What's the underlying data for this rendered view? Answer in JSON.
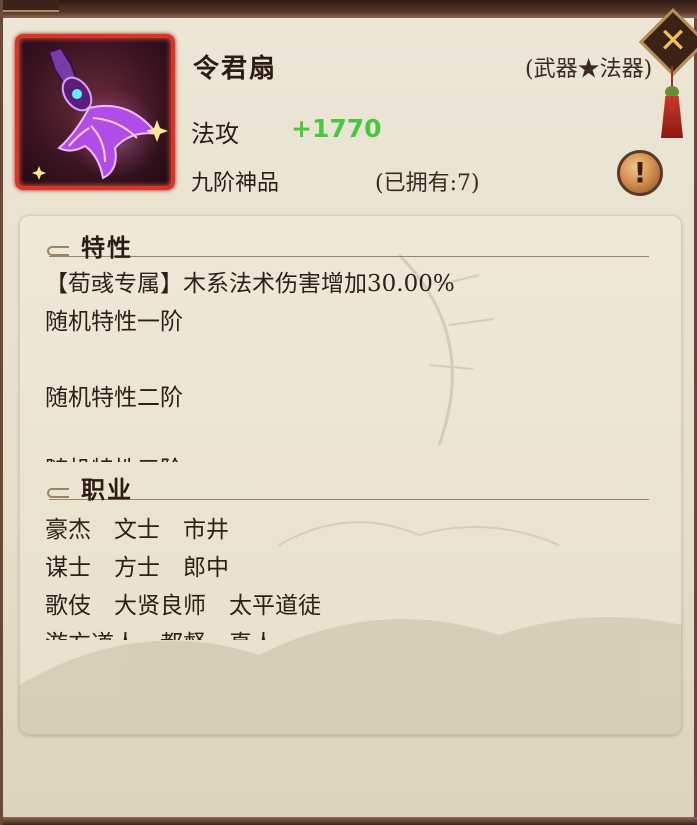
{
  "item": {
    "name": "令君扇",
    "type": "(武器★法器)",
    "stat_label": "法攻",
    "stat_value": "+1770",
    "grade": "九阶神品",
    "owned": "(已拥有:7)"
  },
  "info_button": {
    "glyph": "!"
  },
  "close_button": {
    "glyph": "✕"
  },
  "traits": {
    "header": "特性",
    "rows": [
      "【荀彧专属】木系法术伤害增加30.00%",
      "随机特性一阶",
      "",
      "随机特性二阶",
      "",
      "随机特性三阶"
    ]
  },
  "jobs": {
    "header": "职业",
    "rows": [
      "豪杰　文士　市井",
      "谋士　方士　郎中",
      "歌伎　大贤良师　太平道徒",
      "游方道人　都督　真人"
    ]
  },
  "colors": {
    "stat_value": "#48c640",
    "icon_border": "#d9342b",
    "frame": "#6a4a35"
  }
}
